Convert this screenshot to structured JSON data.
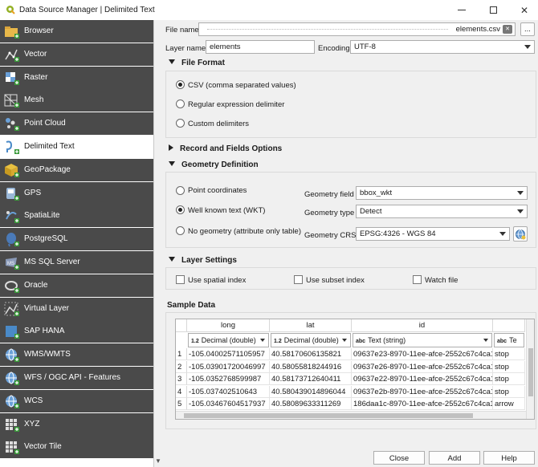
{
  "window": {
    "title": "Data Source Manager | Delimited Text"
  },
  "sidebar": {
    "items": [
      {
        "label": "Browser",
        "icon": "folder-icon"
      },
      {
        "label": "Vector",
        "icon": "vector-icon"
      },
      {
        "label": "Raster",
        "icon": "raster-icon"
      },
      {
        "label": "Mesh",
        "icon": "mesh-icon"
      },
      {
        "label": "Point Cloud",
        "icon": "point-cloud-icon"
      },
      {
        "label": "Delimited Text",
        "icon": "delimited-text-icon"
      },
      {
        "label": "GeoPackage",
        "icon": "geopackage-icon"
      },
      {
        "label": "GPS",
        "icon": "gps-icon"
      },
      {
        "label": "SpatiaLite",
        "icon": "spatialite-icon"
      },
      {
        "label": "PostgreSQL",
        "icon": "postgresql-icon"
      },
      {
        "label": "MS SQL Server",
        "icon": "mssql-icon"
      },
      {
        "label": "Oracle",
        "icon": "oracle-icon"
      },
      {
        "label": "Virtual Layer",
        "icon": "virtual-layer-icon"
      },
      {
        "label": "SAP HANA",
        "icon": "sap-hana-icon"
      },
      {
        "label": "WMS/WMTS",
        "icon": "wms-icon"
      },
      {
        "label": "WFS / OGC API - Features",
        "icon": "wfs-icon"
      },
      {
        "label": "WCS",
        "icon": "wcs-icon"
      },
      {
        "label": "XYZ",
        "icon": "xyz-icon"
      },
      {
        "label": "Vector Tile",
        "icon": "vector-tile-icon"
      }
    ],
    "active_index": 5
  },
  "form": {
    "file_name_label": "File name",
    "file_name_value": "elements.csv",
    "browse_label": "...",
    "layer_name_label": "Layer name",
    "layer_name_value": "elements",
    "encoding_label": "Encoding",
    "encoding_value": "UTF-8"
  },
  "file_format": {
    "title": "File Format",
    "options": [
      "CSV (comma separated values)",
      "Regular expression delimiter",
      "Custom delimiters"
    ],
    "selected_index": 0
  },
  "record_fields": {
    "title": "Record and Fields Options"
  },
  "geometry": {
    "title": "Geometry Definition",
    "options": [
      "Point coordinates",
      "Well known text (WKT)",
      "No geometry (attribute only table)"
    ],
    "selected_index": 1,
    "field_label": "Geometry field",
    "field_value": "bbox_wkt",
    "type_label": "Geometry type",
    "type_value": "Detect",
    "crs_label": "Geometry CRS",
    "crs_value": "EPSG:4326 - WGS 84"
  },
  "layer_settings": {
    "title": "Layer Settings",
    "options": [
      "Use spatial index",
      "Use subset index",
      "Watch file"
    ]
  },
  "sample_data": {
    "title": "Sample Data",
    "columns": [
      {
        "name": "long",
        "type_icon": "1.2",
        "type": "Decimal (double)"
      },
      {
        "name": "lat",
        "type_icon": "1.2",
        "type": "Decimal (double)"
      },
      {
        "name": "id",
        "type_icon": "abc",
        "type": "Text (string)"
      },
      {
        "name": "",
        "type_icon": "abc",
        "type": "Te"
      }
    ],
    "rows": [
      {
        "n": "1",
        "cells": [
          "-105.04002571105957",
          "40.58170606135821",
          "09637e23-8970-11ee-afce-2552c67c4ca1",
          "stop"
        ]
      },
      {
        "n": "2",
        "cells": [
          "-105.03901720046997",
          "40.58055818244916",
          "09637e26-8970-11ee-afce-2552c67c4ca1",
          "stop"
        ]
      },
      {
        "n": "3",
        "cells": [
          "-105.0352768599987",
          "40.58173712640411",
          "09637e22-8970-11ee-afce-2552c67c4ca1",
          "stop"
        ]
      },
      {
        "n": "4",
        "cells": [
          "-105.037402510643",
          "40.580439014896044",
          "09637e2b-8970-11ee-afce-2552c67c4ca1",
          "stop"
        ]
      },
      {
        "n": "5",
        "cells": [
          "-105.03467604517937",
          "40.58089633311269",
          "186daa1c-8970-11ee-afce-2552c67c4ca1",
          "arrow"
        ]
      }
    ]
  },
  "footer": {
    "close_label": "Close",
    "add_label": "Add",
    "help_label": "Help"
  }
}
